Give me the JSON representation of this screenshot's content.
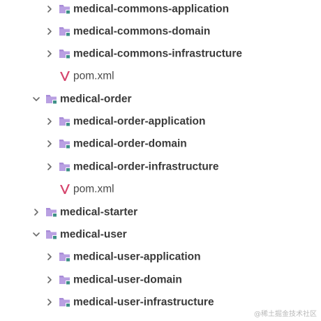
{
  "tree": {
    "items": [
      {
        "label": "medical-commons-application",
        "kind": "module",
        "expanded": false
      },
      {
        "label": "medical-commons-domain",
        "kind": "module",
        "expanded": false
      },
      {
        "label": "medical-commons-infrastructure",
        "kind": "module",
        "expanded": false
      },
      {
        "label": "pom.xml",
        "kind": "maven-file"
      },
      {
        "label": "medical-order",
        "kind": "module",
        "expanded": true
      },
      {
        "label": "medical-order-application",
        "kind": "module",
        "expanded": false
      },
      {
        "label": "medical-order-domain",
        "kind": "module",
        "expanded": false
      },
      {
        "label": "medical-order-infrastructure",
        "kind": "module",
        "expanded": false
      },
      {
        "label": "pom.xml",
        "kind": "maven-file"
      },
      {
        "label": "medical-starter",
        "kind": "module",
        "expanded": false
      },
      {
        "label": "medical-user",
        "kind": "module",
        "expanded": true
      },
      {
        "label": "medical-user-application",
        "kind": "module",
        "expanded": false
      },
      {
        "label": "medical-user-domain",
        "kind": "module",
        "expanded": false
      },
      {
        "label": "medical-user-infrastructure",
        "kind": "module",
        "expanded": false
      }
    ]
  },
  "watermark": "@稀土掘金技术社区",
  "colors": {
    "folder": "#a98cd8",
    "folder_tab": "#b9a0e2",
    "module_badge": "#3d8f86",
    "maven_icon": "#d6466e",
    "chevron": "#6b6b6b",
    "text": "#3a3a3a"
  }
}
